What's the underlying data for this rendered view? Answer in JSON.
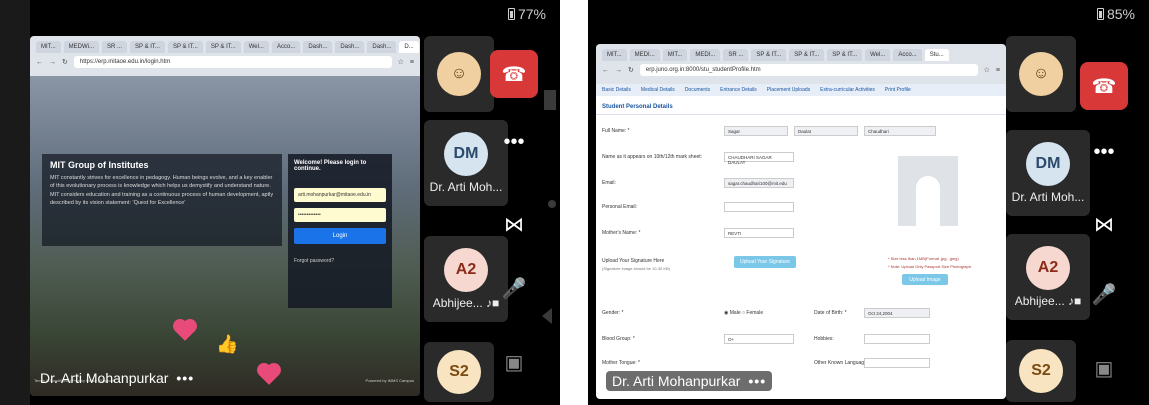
{
  "left": {
    "battery": "77%",
    "tabs": [
      "MIT...",
      "MEDWi...",
      "SR ...",
      "SP & IT...",
      "SP & IT...",
      "SP & IT...",
      "Wel...",
      "Acco...",
      "Dash...",
      "Dash...",
      "Dash...",
      "D..."
    ],
    "url": "https://erp.mitaoe.edu.in/login.htm",
    "login": {
      "org_title": "MIT Group of Institutes",
      "org_description": "MIT constantly strives for excellence in pedagogy. Human beings evolve, and a key enabler of this evolutionary process is knowledge which helps us demystify and understand nature. MIT considers education and training as a continuous process of human development, aptly described by its vision statement: 'Quest for Excellence'",
      "panel_title": "Welcome! Please login to continue.",
      "username_value": "arti.mohanpurkar@mitaoe.edu.in",
      "password_value": "•••••••••••••",
      "login_button": "Login",
      "forgot_password": "Forgot password?",
      "footer_left": "Terms & Conditions | Privacy Policy | Support",
      "footer_right": "Powered by iMMS Campus"
    },
    "presenter_name": "Dr. Arti Mohanpurkar",
    "participants": [
      {
        "initials": "",
        "color": "#f0d0a0",
        "text_color": "#5a3a10",
        "label": ""
      },
      {
        "initials": "DM",
        "color": "#d6e4f0",
        "text_color": "#2c4a6a",
        "label": "Dr. Arti Moh..."
      },
      {
        "initials": "A2",
        "color": "#f7d8d0",
        "text_color": "#8a2c1a",
        "label": "Abhijee... ♪■"
      },
      {
        "initials": "S2",
        "color": "#f8e4c0",
        "text_color": "#7a4a10",
        "label": ""
      }
    ],
    "controls": [
      "end-call",
      "more",
      "bluetooth",
      "mic-off",
      "camera-off"
    ]
  },
  "right": {
    "battery": "85%",
    "tabs": [
      "MIT...",
      "MEDI...",
      "MIT...",
      "MEDI...",
      "SR ...",
      "SP & IT...",
      "SP & IT...",
      "SP & IT...",
      "Wel...",
      "Acco...",
      "Stu..."
    ],
    "url": "erp.juno.org.in:8000/stu_studentProfile.htm",
    "nav_items": [
      "Basic Details",
      "Medical Details",
      "Documents",
      "Entrance Details",
      "Placement Uploads",
      "Extra-curricular Activities",
      "Print Profile"
    ],
    "section_title": "Student Personal Details",
    "fields": {
      "full_name_label": "Full Name: *",
      "first_name": "Sagar",
      "middle_name": "Daulat",
      "last_name": "Chaudhari",
      "name_as_marksheet_label": "Name as it appears on 10th/12th mark sheet:",
      "name_as_marksheet": "CHAUDHARI SAGAR DAULAT",
      "email_label": "Email:",
      "email": "sagar.chaudhari100@mit.edu",
      "personal_email_label": "Personal Email:",
      "mothers_name_label": "Mother's Name: *",
      "mothers_name": "REVTI",
      "signature_label": "Upload Your Signature Here",
      "signature_note": "(Signature image should be 10-30 KB)",
      "upload_signature_button": "Upload Your Signature",
      "photo_note_1": "* Size less than 1MB(Format .jpg, .jpeg)",
      "photo_note_2": "* Note: Upload Only Passport Size Photograph.",
      "upload_image_button": "Upload Image",
      "gender_label": "Gender: *",
      "gender_male": "Male",
      "gender_female": "Female",
      "dob_label": "Date of Birth: *",
      "dob": "Oct 24,2004",
      "blood_group_label": "Blood Group: *",
      "blood_group": "O+",
      "hobbies_label": "Hobbies:",
      "mother_tongue_label": "Mother Tongue: *",
      "other_language_label": "Other Known Language :"
    },
    "presenter_name": "Dr. Arti Mohanpurkar"
  }
}
